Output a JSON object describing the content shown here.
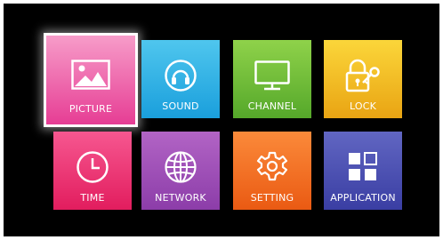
{
  "menu": {
    "selected": "picture",
    "tiles": {
      "picture": {
        "label": "PICTURE",
        "icon": "picture-icon",
        "color_top": "#f79cc9",
        "color_bottom": "#e63d94"
      },
      "sound": {
        "label": "SOUND",
        "icon": "headphones-icon",
        "color_top": "#4fc6ee",
        "color_bottom": "#1a9fdc"
      },
      "channel": {
        "label": "CHANNEL",
        "icon": "tv-icon",
        "color_top": "#8fd24a",
        "color_bottom": "#55a82a"
      },
      "lock": {
        "label": "LOCK",
        "icon": "lock-key-icon",
        "color_top": "#fbd63a",
        "color_bottom": "#e9a413"
      },
      "time": {
        "label": "TIME",
        "icon": "clock-icon",
        "color_top": "#f65790",
        "color_bottom": "#e21d5e"
      },
      "network": {
        "label": "NETWORK",
        "icon": "globe-icon",
        "color_top": "#b264c5",
        "color_bottom": "#8c3da9"
      },
      "setting": {
        "label": "SETTING",
        "icon": "gear-icon",
        "color_top": "#fb8a3a",
        "color_bottom": "#ea5a13"
      },
      "application": {
        "label": "APPLICATION",
        "icon": "app-grid-icon",
        "color_top": "#6166c2",
        "color_bottom": "#3a3ea3"
      }
    }
  }
}
